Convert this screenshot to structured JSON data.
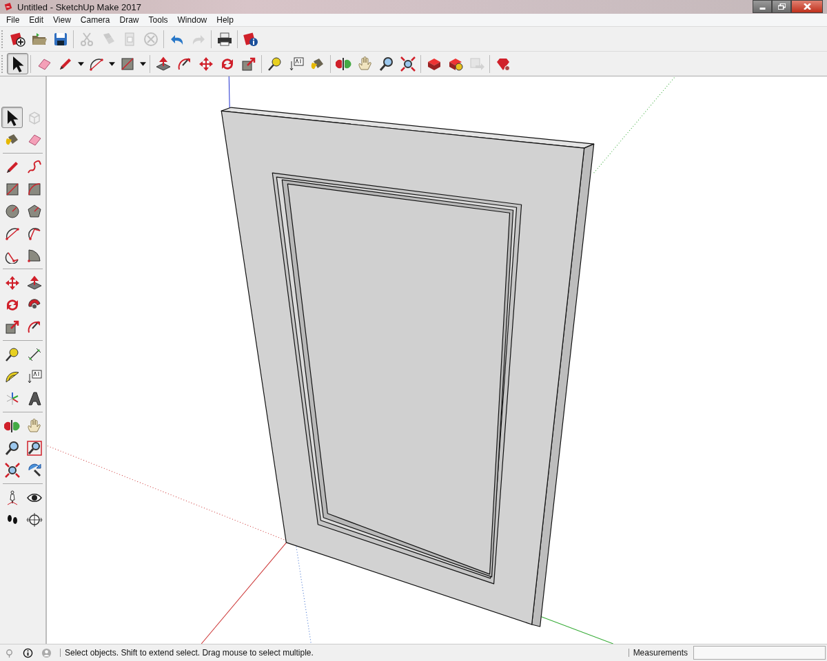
{
  "window": {
    "title": "Untitled - SketchUp Make 2017"
  },
  "menu": [
    "File",
    "Edit",
    "View",
    "Camera",
    "Draw",
    "Tools",
    "Window",
    "Help"
  ],
  "top_toolbars": [
    [
      [
        {
          "kind": "new",
          "selected": false,
          "disabled": false
        },
        {
          "kind": "open",
          "selected": false,
          "disabled": false
        },
        {
          "kind": "save",
          "selected": false,
          "disabled": false
        }
      ],
      [
        {
          "kind": "cut",
          "selected": false,
          "disabled": true
        },
        {
          "kind": "copy",
          "selected": false,
          "disabled": true
        },
        {
          "kind": "paste",
          "selected": false,
          "disabled": true
        },
        {
          "kind": "erase",
          "selected": false,
          "disabled": true
        }
      ],
      [
        {
          "kind": "undo",
          "selected": false,
          "disabled": false
        },
        {
          "kind": "redo",
          "selected": false,
          "disabled": true
        }
      ],
      [
        {
          "kind": "print",
          "selected": false,
          "disabled": false
        }
      ],
      [
        {
          "kind": "modelinfo",
          "selected": false,
          "disabled": false
        }
      ]
    ],
    [
      [
        {
          "kind": "select",
          "selected": true,
          "disabled": false,
          "dropdown": false
        }
      ],
      [
        {
          "kind": "eraser",
          "selected": false,
          "disabled": false,
          "dropdown": false
        },
        {
          "kind": "pencil",
          "selected": false,
          "disabled": false,
          "dropdown": true
        },
        {
          "kind": "arc",
          "selected": false,
          "disabled": false,
          "dropdown": true
        },
        {
          "kind": "rectangle",
          "selected": false,
          "disabled": false,
          "dropdown": true
        }
      ],
      [
        {
          "kind": "pushpull",
          "selected": false,
          "disabled": false,
          "dropdown": false
        },
        {
          "kind": "offset",
          "selected": false,
          "disabled": false,
          "dropdown": false
        },
        {
          "kind": "move",
          "selected": false,
          "disabled": false,
          "dropdown": false
        },
        {
          "kind": "rotate",
          "selected": false,
          "disabled": false,
          "dropdown": false
        },
        {
          "kind": "scale",
          "selected": false,
          "disabled": false,
          "dropdown": false
        }
      ],
      [
        {
          "kind": "tape",
          "selected": false,
          "disabled": false,
          "dropdown": false
        },
        {
          "kind": "text",
          "selected": false,
          "disabled": false,
          "dropdown": false
        },
        {
          "kind": "paint",
          "selected": false,
          "disabled": false,
          "dropdown": false
        }
      ],
      [
        {
          "kind": "orbit",
          "selected": false,
          "disabled": false,
          "dropdown": false
        },
        {
          "kind": "pan",
          "selected": false,
          "disabled": false,
          "dropdown": false
        },
        {
          "kind": "zoom",
          "selected": false,
          "disabled": false,
          "dropdown": false
        },
        {
          "kind": "zoomextents",
          "selected": false,
          "disabled": false,
          "dropdown": false
        }
      ],
      [
        {
          "kind": "warehouse",
          "selected": false,
          "disabled": false,
          "dropdown": false
        },
        {
          "kind": "extension",
          "selected": false,
          "disabled": false,
          "dropdown": false
        },
        {
          "kind": "share",
          "selected": false,
          "disabled": true,
          "dropdown": false
        }
      ],
      [
        {
          "kind": "ruby",
          "selected": false,
          "disabled": false,
          "dropdown": false
        }
      ]
    ]
  ],
  "side_toolbar": [
    [
      {
        "kind": "select",
        "selected": true,
        "disabled": false
      },
      {
        "kind": "component",
        "selected": false,
        "disabled": true
      },
      {
        "kind": "paint",
        "selected": false,
        "disabled": false
      },
      {
        "kind": "eraser",
        "selected": false,
        "disabled": false
      }
    ],
    [
      {
        "kind": "pencil",
        "selected": false,
        "disabled": false
      },
      {
        "kind": "freehand",
        "selected": false,
        "disabled": false
      },
      {
        "kind": "rectangle",
        "selected": false,
        "disabled": false
      },
      {
        "kind": "rotrect",
        "selected": false,
        "disabled": false
      },
      {
        "kind": "circle",
        "selected": false,
        "disabled": false
      },
      {
        "kind": "polygon",
        "selected": false,
        "disabled": false
      },
      {
        "kind": "arc",
        "selected": false,
        "disabled": false
      },
      {
        "kind": "arc2",
        "selected": false,
        "disabled": false
      },
      {
        "kind": "arc3",
        "selected": false,
        "disabled": false
      },
      {
        "kind": "pie",
        "selected": false,
        "disabled": false
      }
    ],
    [
      {
        "kind": "move",
        "selected": false,
        "disabled": false
      },
      {
        "kind": "pushpull",
        "selected": false,
        "disabled": false
      },
      {
        "kind": "rotate",
        "selected": false,
        "disabled": false
      },
      {
        "kind": "followme",
        "selected": false,
        "disabled": false
      },
      {
        "kind": "scale",
        "selected": false,
        "disabled": false
      },
      {
        "kind": "offset",
        "selected": false,
        "disabled": false
      }
    ],
    [
      {
        "kind": "tape",
        "selected": false,
        "disabled": false
      },
      {
        "kind": "dimension",
        "selected": false,
        "disabled": false
      },
      {
        "kind": "protractor",
        "selected": false,
        "disabled": false
      },
      {
        "kind": "text",
        "selected": false,
        "disabled": false
      },
      {
        "kind": "axes",
        "selected": false,
        "disabled": false
      },
      {
        "kind": "text3d",
        "selected": false,
        "disabled": false
      }
    ],
    [
      {
        "kind": "orbit",
        "selected": false,
        "disabled": false
      },
      {
        "kind": "pan",
        "selected": false,
        "disabled": false
      },
      {
        "kind": "zoom",
        "selected": false,
        "disabled": false
      },
      {
        "kind": "zoomwindow",
        "selected": false,
        "disabled": false
      },
      {
        "kind": "zoomextents",
        "selected": false,
        "disabled": false
      },
      {
        "kind": "previous",
        "selected": false,
        "disabled": false
      }
    ],
    [
      {
        "kind": "camera",
        "selected": false,
        "disabled": false
      },
      {
        "kind": "lookaround",
        "selected": false,
        "disabled": false
      },
      {
        "kind": "walk",
        "selected": false,
        "disabled": false
      },
      {
        "kind": "section",
        "selected": false,
        "disabled": false
      }
    ]
  ],
  "status_bar": {
    "hint": "Select objects. Shift to extend select. Drag mouse to select multiple.",
    "measurements_label": "Measurements"
  }
}
